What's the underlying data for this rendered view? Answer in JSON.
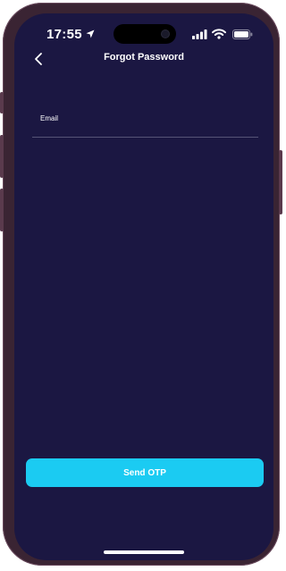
{
  "status_bar": {
    "time": "17:55",
    "location_icon": "location-arrow-icon",
    "signal_icon": "cellular-signal-icon",
    "wifi_icon": "wifi-icon",
    "battery_icon": "battery-icon"
  },
  "nav": {
    "back_icon": "chevron-left-icon",
    "title": "Forgot Password"
  },
  "form": {
    "email_label": "Email",
    "email_value": "",
    "send_otp_label": "Send OTP"
  },
  "colors": {
    "background": "#1b1742",
    "accent": "#1bcbf2",
    "divider": "#565477",
    "text": "#ffffff"
  }
}
